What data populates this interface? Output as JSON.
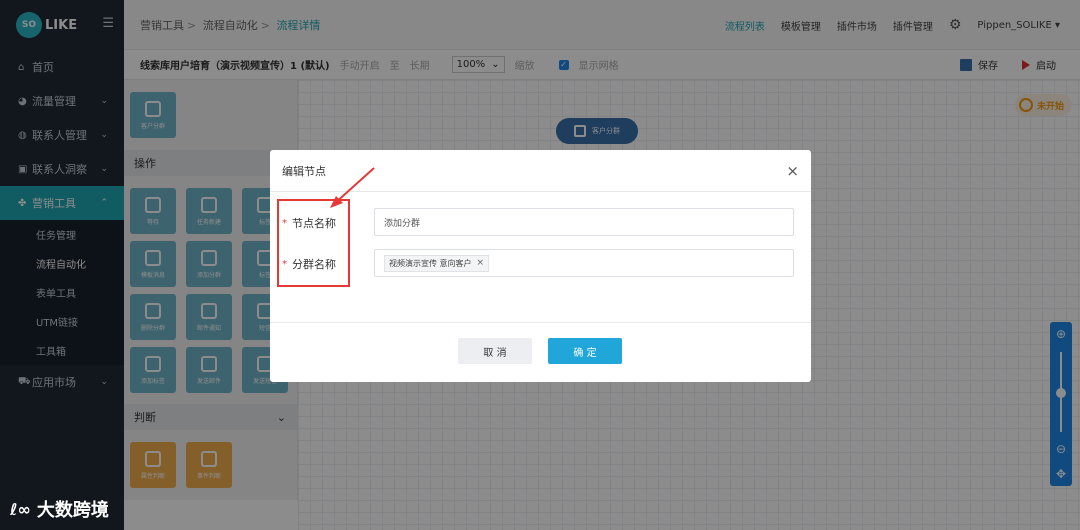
{
  "logo": {
    "badge": "SO",
    "text": "LIKE"
  },
  "sidebar": {
    "items": [
      {
        "icon": "home-icon",
        "glyph": "⌂",
        "label": "首页"
      },
      {
        "icon": "pie-icon",
        "glyph": "◕",
        "label": "流量管理"
      },
      {
        "icon": "users-icon",
        "glyph": "◍",
        "label": "联系人管理"
      },
      {
        "icon": "idcard-icon",
        "glyph": "▣",
        "label": "联系人洞察"
      },
      {
        "icon": "share-icon",
        "glyph": "✤",
        "label": "营销工具"
      }
    ],
    "sub": [
      "任务管理",
      "流程自动化",
      "表单工具",
      "UTM链接",
      "工具箱"
    ],
    "app_market": {
      "icon": "cart-icon",
      "glyph": "⛟",
      "label": "应用市场"
    }
  },
  "breadcrumb": {
    "a": "营销工具",
    "b": "流程自动化",
    "c": "流程详情"
  },
  "top_links": [
    "流程列表",
    "模板管理",
    "插件市场",
    "插件管理"
  ],
  "user": "Pippen_SOLIKE",
  "toolbar": {
    "flow_title": "线索库用户培育（演示视频宣传）1 (默认)",
    "start": "手动开启",
    "to": "至",
    "end": "长期",
    "zoom": "100%",
    "zoom_label": "缩放",
    "grid_label": "显示网格",
    "save": "保存",
    "run": "启动"
  },
  "palette": {
    "top_tile": "客户分群",
    "ops_title": "操作",
    "ops_tiles": [
      "等待",
      "任务新建",
      "标签",
      "模板消息",
      "添加分群",
      "标签",
      "删除分群",
      "邮件通知",
      "短信",
      "添加标签",
      "发送邮件",
      "发送短信"
    ],
    "judge_title": "判断",
    "judge_tiles": [
      "属性判断",
      "事件判断"
    ]
  },
  "canvas": {
    "node_label": "客户分群",
    "status": "未开始"
  },
  "modal": {
    "title": "编辑节点",
    "close": "×",
    "req": "*",
    "field1_label": "节点名称",
    "field1_value": "添加分群",
    "field2_label": "分群名称",
    "field2_tag": "视频演示宣传 意向客户",
    "tag_close": "×",
    "cancel": "取 消",
    "ok": "确 定"
  },
  "watermark": "大数跨境"
}
